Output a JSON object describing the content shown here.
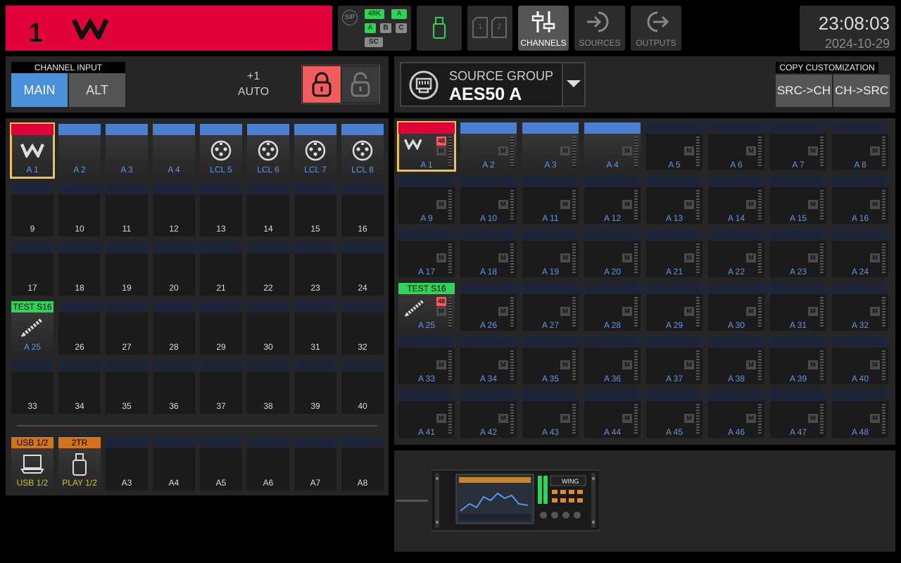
{
  "topbar": {
    "channel_number": "1",
    "status": {
      "sip": "SIP",
      "rate": "48K",
      "a1": "A",
      "a2": "A",
      "b": "B",
      "c": "C",
      "sc": "SC"
    },
    "sd_labels": [
      "1",
      "2"
    ],
    "channels_label": "CHANNELS",
    "sources_label": "SOURCES",
    "outputs_label": "OUTPUTS",
    "time": "23:08:03",
    "date": "2024-10-29"
  },
  "channel_input": {
    "title": "CHANNEL INPUT",
    "main_label": "MAIN",
    "alt_label": "ALT",
    "trim_value": "+1",
    "trim_mode": "AUTO"
  },
  "left_tiles": [
    {
      "label": "A 1",
      "bar": "red",
      "label_color": "blue",
      "icon": "wing-logo",
      "selected": true,
      "grad": true
    },
    {
      "label": "A 2",
      "bar": "blue",
      "label_color": "blue",
      "grad": true
    },
    {
      "label": "A 3",
      "bar": "blue",
      "label_color": "blue",
      "grad": true
    },
    {
      "label": "A 4",
      "bar": "blue",
      "label_color": "blue",
      "grad": true
    },
    {
      "label": "LCL 5",
      "bar": "blue",
      "label_color": "blue",
      "icon": "xlr",
      "grad": true
    },
    {
      "label": "LCL 6",
      "bar": "blue",
      "label_color": "blue",
      "icon": "xlr",
      "grad": true
    },
    {
      "label": "LCL 7",
      "bar": "blue",
      "label_color": "blue",
      "icon": "xlr",
      "grad": true
    },
    {
      "label": "LCL 8",
      "bar": "blue",
      "label_color": "blue",
      "icon": "xlr",
      "grad": true
    },
    {
      "label": "9"
    },
    {
      "label": "10"
    },
    {
      "label": "11"
    },
    {
      "label": "12"
    },
    {
      "label": "13"
    },
    {
      "label": "14"
    },
    {
      "label": "15"
    },
    {
      "label": "16"
    },
    {
      "label": "17"
    },
    {
      "label": "18"
    },
    {
      "label": "19"
    },
    {
      "label": "20"
    },
    {
      "label": "21"
    },
    {
      "label": "22"
    },
    {
      "label": "23"
    },
    {
      "label": "24"
    },
    {
      "label": "A 25",
      "bar": "green",
      "bar_text": "TEST S16",
      "label_color": "blue",
      "icon": "snake",
      "grad": true
    },
    {
      "label": "26"
    },
    {
      "label": "27"
    },
    {
      "label": "28"
    },
    {
      "label": "29"
    },
    {
      "label": "30"
    },
    {
      "label": "31"
    },
    {
      "label": "32"
    },
    {
      "label": "33"
    },
    {
      "label": "34"
    },
    {
      "label": "35"
    },
    {
      "label": "36"
    },
    {
      "label": "37"
    },
    {
      "label": "38"
    },
    {
      "label": "39"
    },
    {
      "label": "40"
    }
  ],
  "aux_tiles": [
    {
      "label": "USB 1/2",
      "bar": "orange",
      "bar_text": "USB 1/2",
      "label_color": "yellow",
      "icon": "laptop",
      "grad": true
    },
    {
      "label": "PLAY 1/2",
      "bar": "orange",
      "bar_text": "2TR",
      "label_color": "yellow",
      "icon": "usb-stick",
      "grad": true
    },
    {
      "label": "A3"
    },
    {
      "label": "A4"
    },
    {
      "label": "A5"
    },
    {
      "label": "A6"
    },
    {
      "label": "A7"
    },
    {
      "label": "A8"
    }
  ],
  "source_group": {
    "title": "SOURCE GROUP",
    "value": "AES50 A"
  },
  "copy_customization": {
    "title": "COPY CUSTOMIZATION",
    "src_to_ch": "SRC->CH",
    "ch_to_src": "CH->SRC"
  },
  "source_tiles": [
    {
      "label": "A 1",
      "bar": "red",
      "phantom": "48",
      "icon": "wing-logo",
      "selected": true,
      "grad": true
    },
    {
      "label": "A 2",
      "bar": "blue",
      "grad": true
    },
    {
      "label": "A 3",
      "bar": "blue",
      "grad": true
    },
    {
      "label": "A 4",
      "bar": "blue",
      "grad": true
    },
    {
      "label": "A 5"
    },
    {
      "label": "A 6"
    },
    {
      "label": "A 7"
    },
    {
      "label": "A 8"
    },
    {
      "label": "A 9"
    },
    {
      "label": "A 10"
    },
    {
      "label": "A 11"
    },
    {
      "label": "A 12"
    },
    {
      "label": "A 13"
    },
    {
      "label": "A 14"
    },
    {
      "label": "A 15"
    },
    {
      "label": "A 16"
    },
    {
      "label": "A 17"
    },
    {
      "label": "A 18"
    },
    {
      "label": "A 19"
    },
    {
      "label": "A 20"
    },
    {
      "label": "A 21"
    },
    {
      "label": "A 22"
    },
    {
      "label": "A 23"
    },
    {
      "label": "A 24"
    },
    {
      "label": "A 25",
      "bar": "green",
      "bar_text": "TEST S16",
      "phantom": "48",
      "icon": "snake",
      "grad": true
    },
    {
      "label": "A 26"
    },
    {
      "label": "A 27"
    },
    {
      "label": "A 28"
    },
    {
      "label": "A 29"
    },
    {
      "label": "A 30"
    },
    {
      "label": "A 31"
    },
    {
      "label": "A 32"
    },
    {
      "label": "A 33"
    },
    {
      "label": "A 34"
    },
    {
      "label": "A 35"
    },
    {
      "label": "A 36"
    },
    {
      "label": "A 37"
    },
    {
      "label": "A 38"
    },
    {
      "label": "A 39"
    },
    {
      "label": "A 40"
    },
    {
      "label": "A 41"
    },
    {
      "label": "A 42"
    },
    {
      "label": "A 43"
    },
    {
      "label": "A 44"
    },
    {
      "label": "A 45"
    },
    {
      "label": "A 46"
    },
    {
      "label": "A 47"
    },
    {
      "label": "A 48"
    }
  ],
  "mute_label": "M",
  "device": {
    "brand_text": "WING"
  },
  "colors": {
    "channel_red": "#e0003a",
    "accent_blue": "#4a90d8",
    "select_yellow": "#f2c14e",
    "ok_green": "#2fd35a",
    "usb_orange": "#d4731a"
  }
}
